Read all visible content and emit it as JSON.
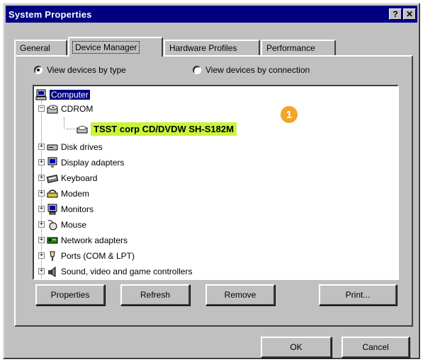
{
  "window": {
    "title": "System Properties",
    "help_glyph": "?",
    "close_glyph": "✕"
  },
  "tabs": [
    {
      "label": "General"
    },
    {
      "label": "Device Manager",
      "active": true
    },
    {
      "label": "Hardware Profiles"
    },
    {
      "label": "Performance"
    }
  ],
  "view_options": {
    "by_type": {
      "label": "View devices by type",
      "selected": true
    },
    "by_connection": {
      "label": "View devices by connection",
      "selected": false
    }
  },
  "tree": {
    "root": {
      "label": "Computer",
      "icon": "computer-icon"
    },
    "items": [
      {
        "label": "CDROM",
        "icon": "cdrom-icon",
        "expander": "−"
      },
      {
        "label": "TSST corp CD/DVDW SH-S182M",
        "icon": "cdrom-drive-icon",
        "child": true,
        "badge": "1"
      },
      {
        "label": "Disk drives",
        "icon": "disk-drive-icon",
        "expander": "+"
      },
      {
        "label": "Display adapters",
        "icon": "display-adapter-icon",
        "expander": "+"
      },
      {
        "label": "Keyboard",
        "icon": "keyboard-icon",
        "expander": "+"
      },
      {
        "label": "Modem",
        "icon": "modem-icon",
        "expander": "+"
      },
      {
        "label": "Monitors",
        "icon": "monitor-icon",
        "expander": "+"
      },
      {
        "label": "Mouse",
        "icon": "mouse-icon",
        "expander": "+"
      },
      {
        "label": "Network adapters",
        "icon": "network-adapter-icon",
        "expander": "+"
      },
      {
        "label": "Ports (COM & LPT)",
        "icon": "ports-icon",
        "expander": "+"
      },
      {
        "label": "Sound, video and game controllers",
        "icon": "sound-icon",
        "expander": "+"
      }
    ]
  },
  "actions": {
    "properties": "Properties",
    "refresh": "Refresh",
    "remove": "Remove",
    "print": "Print..."
  },
  "footer": {
    "ok": "OK",
    "cancel": "Cancel"
  },
  "colors": {
    "titlebar": "#000080",
    "highlight": "#c8f53a",
    "badge": "#f2a52a"
  }
}
